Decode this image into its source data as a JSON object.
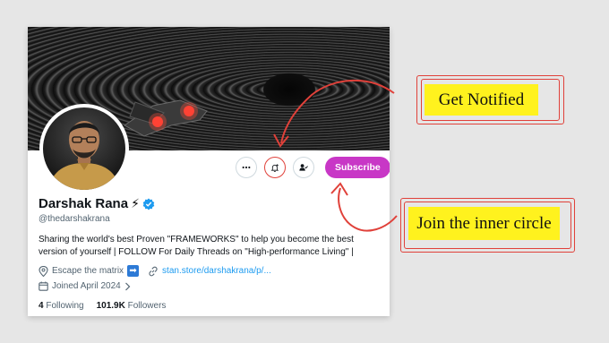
{
  "profile": {
    "name": "Darshak Rana",
    "badge_emoji": "⚡",
    "handle": "@thedarshakrana",
    "bio": "Sharing the world's best Proven \"FRAMEWORKS\" to help you become the best version of yourself | FOLLOW For Daily Threads on \"High-performance Living\" |",
    "location": "Escape the matrix",
    "location_emoji": "➡️",
    "link": "stan.store/darshakrana/p/...",
    "joined": "Joined April 2024",
    "following_count": "4",
    "following_label": "Following",
    "followers_count": "101.9K",
    "followers_label": "Followers"
  },
  "actions": {
    "subscribe_label": "Subscribe",
    "more_icon": "more-icon",
    "notify_icon": "bell-plus-icon",
    "user_icon": "user-check-icon"
  },
  "annotations": {
    "get_notified": "Get Notified",
    "join": "Join the inner circle"
  },
  "colors": {
    "subscribe": "#c837c6",
    "verified": "#1d9bf0",
    "link": "#1d9bf0",
    "callout": "#fff21e",
    "annotation_red": "#e0413a"
  }
}
